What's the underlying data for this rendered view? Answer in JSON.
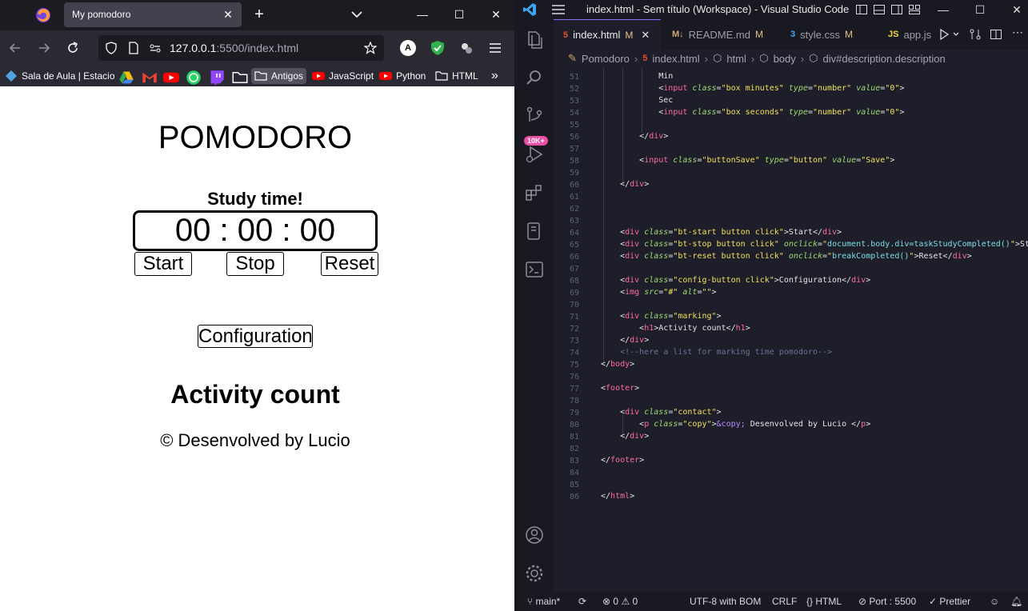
{
  "firefox": {
    "tab_title": "My pomodoro",
    "url_main": "127.0.0.1",
    "url_rest": ":5500/index.html",
    "bookmarks": [
      "Sala de Aula | Estacio",
      "Antigos",
      "JavaScript",
      "Python",
      "HTML"
    ],
    "ext_label": "A"
  },
  "page": {
    "title": "POMODORO",
    "study_label": "Study time!",
    "timer": "00 : 00 : 00",
    "start_label": "Start",
    "stop_label": "Stop",
    "reset_label": "Reset",
    "config_label": "Configuration",
    "activity_heading": "Activity count",
    "copyright": "© Desenvolved by Lucio"
  },
  "vscode": {
    "window_title": "index.html - Sem título (Workspace) - Visual Studio Code",
    "tabs": [
      {
        "label": "index.html",
        "mod": "M"
      },
      {
        "label": "README.md",
        "mod": "M"
      },
      {
        "label": "style.css",
        "mod": "M"
      },
      {
        "label": "app.js",
        "mod": ""
      }
    ],
    "breadcrumb": [
      "Pomodoro",
      "index.html",
      "html",
      "body",
      "div#description.description"
    ],
    "badge": "10K+",
    "status": {
      "branch": "main*",
      "problems": "0",
      "warnings": "0",
      "encoding": "UTF-8 with BOM",
      "eol": "CRLF",
      "language": "HTML",
      "port": "Port : 5500",
      "prettier": "Prettier"
    }
  }
}
